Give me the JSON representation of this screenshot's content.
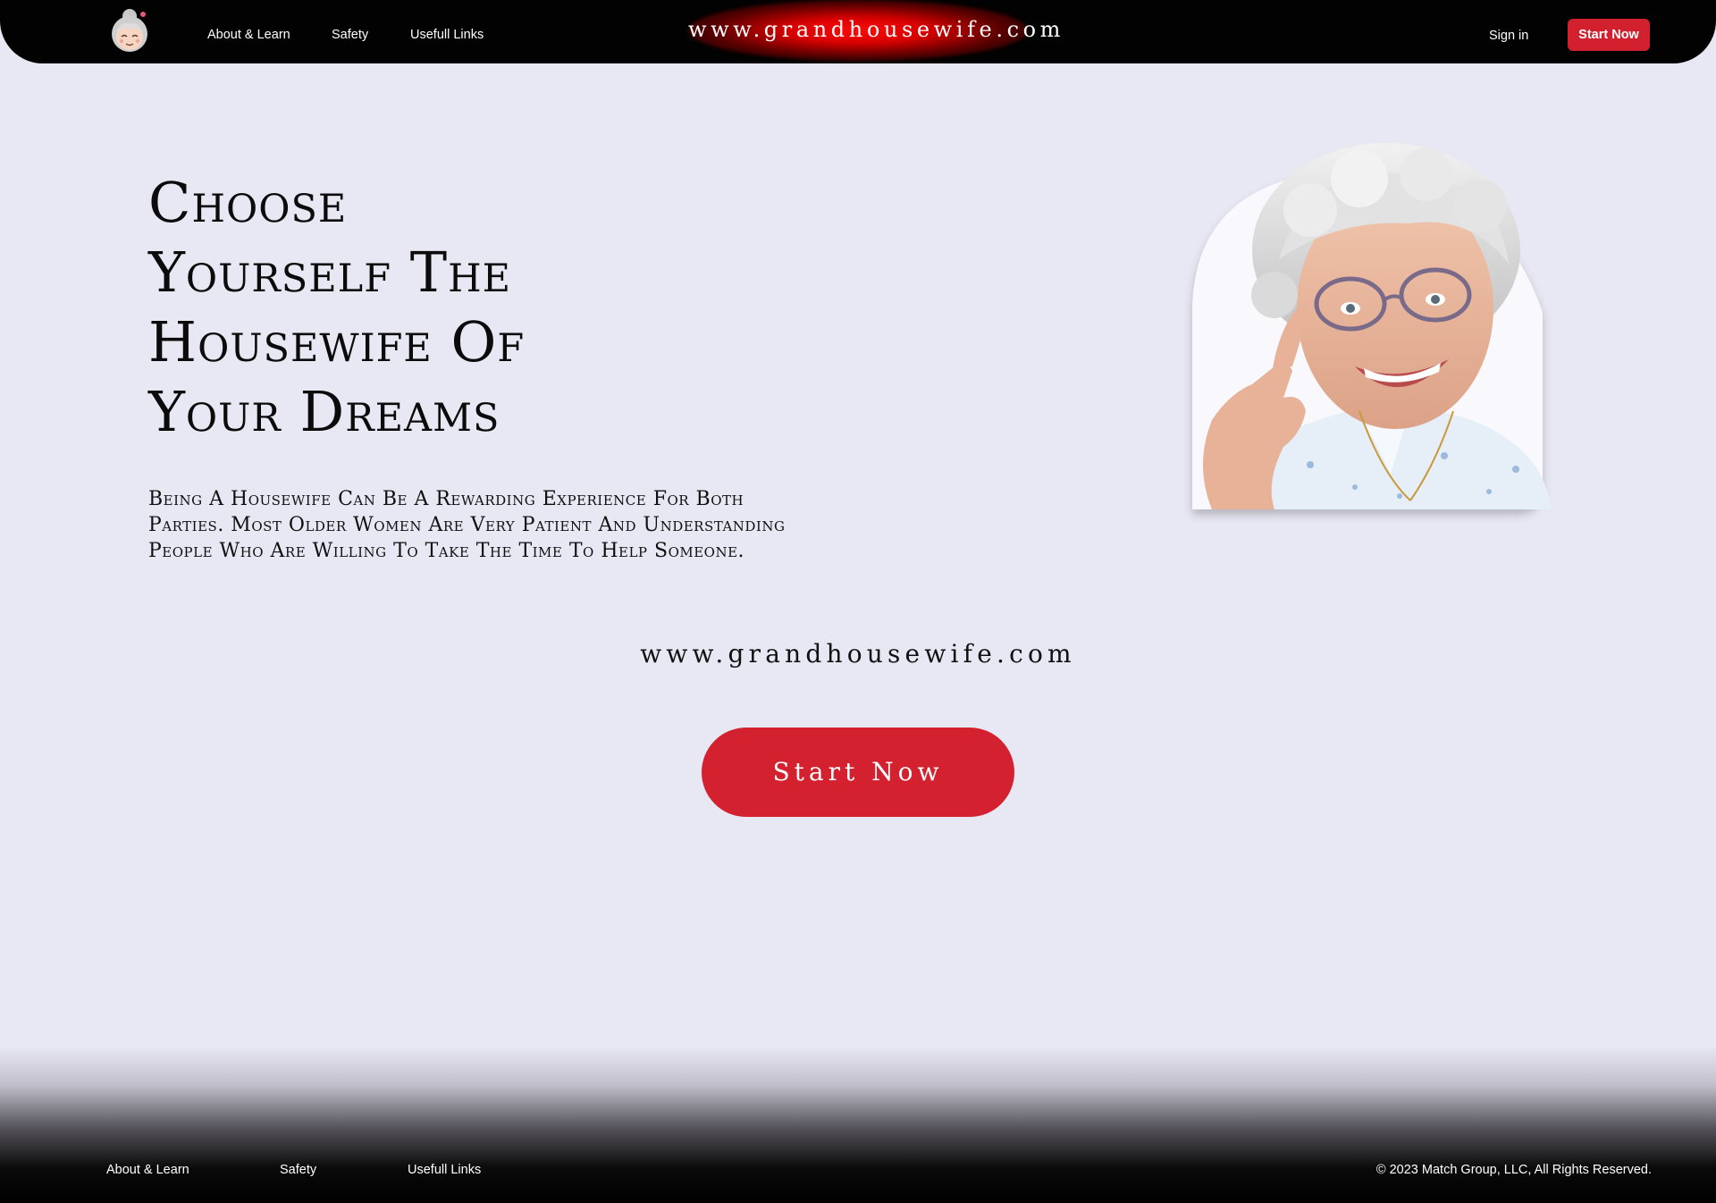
{
  "header": {
    "logo_icon": "grandmother-face-icon",
    "nav": [
      {
        "label": "About & Learn"
      },
      {
        "label": "Safety"
      },
      {
        "label": "Usefull Links"
      }
    ],
    "brand": "www.grandhousewife.com",
    "sign_in": "Sign in",
    "cta": "Start Now"
  },
  "hero": {
    "title_lines": [
      "Choose",
      "Yourself The",
      "Housewife Of",
      "Your Dreams"
    ],
    "description": "Being A Housewife Can Be A Rewarding Experience For Both Parties. Most Older Women Are Very Patient And Understanding People Who Are Willing To Take The Time To Help Someone.",
    "url": "www.grandhousewife.com",
    "cta": "Start Now"
  },
  "footer": {
    "nav": [
      {
        "label": "About & Learn"
      },
      {
        "label": "Safety"
      },
      {
        "label": "Usefull Links"
      }
    ],
    "copyright": "© 2023 Match Group, LLC, All Rights Reserved."
  },
  "colors": {
    "background": "#e8e7f4",
    "header": "#020202",
    "accent": "#d4212f",
    "brand_glow": "#e00000"
  }
}
